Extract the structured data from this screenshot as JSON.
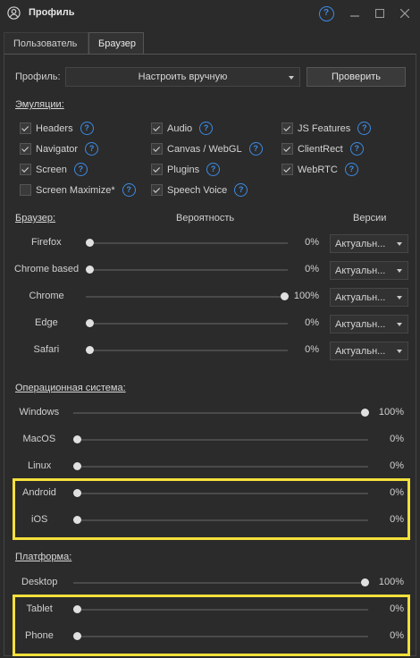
{
  "window": {
    "title": "Профиль"
  },
  "tabs": [
    {
      "label": "Пользователь"
    },
    {
      "label": "Браузер"
    }
  ],
  "profile": {
    "label": "Профиль:",
    "selected": "Настроить вручную",
    "check_button": "Проверить"
  },
  "emulations": {
    "title": "Эмуляции:",
    "items": [
      {
        "label": "Headers",
        "checked": true
      },
      {
        "label": "Audio",
        "checked": true
      },
      {
        "label": "JS Features",
        "checked": true
      },
      {
        "label": "Navigator",
        "checked": true
      },
      {
        "label": "Canvas / WebGL",
        "checked": true
      },
      {
        "label": "ClientRect",
        "checked": true
      },
      {
        "label": "Screen",
        "checked": true
      },
      {
        "label": "Plugins",
        "checked": true
      },
      {
        "label": "WebRTC",
        "checked": true
      },
      {
        "label": "Screen Maximize*",
        "checked": false
      },
      {
        "label": "Speech Voice",
        "checked": true
      }
    ]
  },
  "browser": {
    "title": "Браузер:",
    "probability_header": "Вероятность",
    "versions_header": "Версии",
    "rows": [
      {
        "name": "Firefox",
        "value": 0,
        "pct": "0%",
        "version": "Актуальн..."
      },
      {
        "name": "Chrome based",
        "value": 0,
        "pct": "0%",
        "version": "Актуальн..."
      },
      {
        "name": "Chrome",
        "value": 100,
        "pct": "100%",
        "version": "Актуальн..."
      },
      {
        "name": "Edge",
        "value": 0,
        "pct": "0%",
        "version": "Актуальн..."
      },
      {
        "name": "Safari",
        "value": 0,
        "pct": "0%",
        "version": "Актуальн..."
      }
    ]
  },
  "os": {
    "title": "Операционная система:",
    "rows": [
      {
        "name": "Windows",
        "value": 100,
        "pct": "100%"
      },
      {
        "name": "MacOS",
        "value": 0,
        "pct": "0%"
      },
      {
        "name": "Linux",
        "value": 0,
        "pct": "0%"
      },
      {
        "name": "Android",
        "value": 0,
        "pct": "0%"
      },
      {
        "name": "iOS",
        "value": 0,
        "pct": "0%"
      }
    ]
  },
  "platform": {
    "title": "Платформа:",
    "rows": [
      {
        "name": "Desktop",
        "value": 100,
        "pct": "100%"
      },
      {
        "name": "Tablet",
        "value": 0,
        "pct": "0%"
      },
      {
        "name": "Phone",
        "value": 0,
        "pct": "0%"
      }
    ]
  },
  "colors": {
    "accent": "#3d8be3",
    "highlight": "#f4e03b",
    "background": "#2b2b2b"
  }
}
